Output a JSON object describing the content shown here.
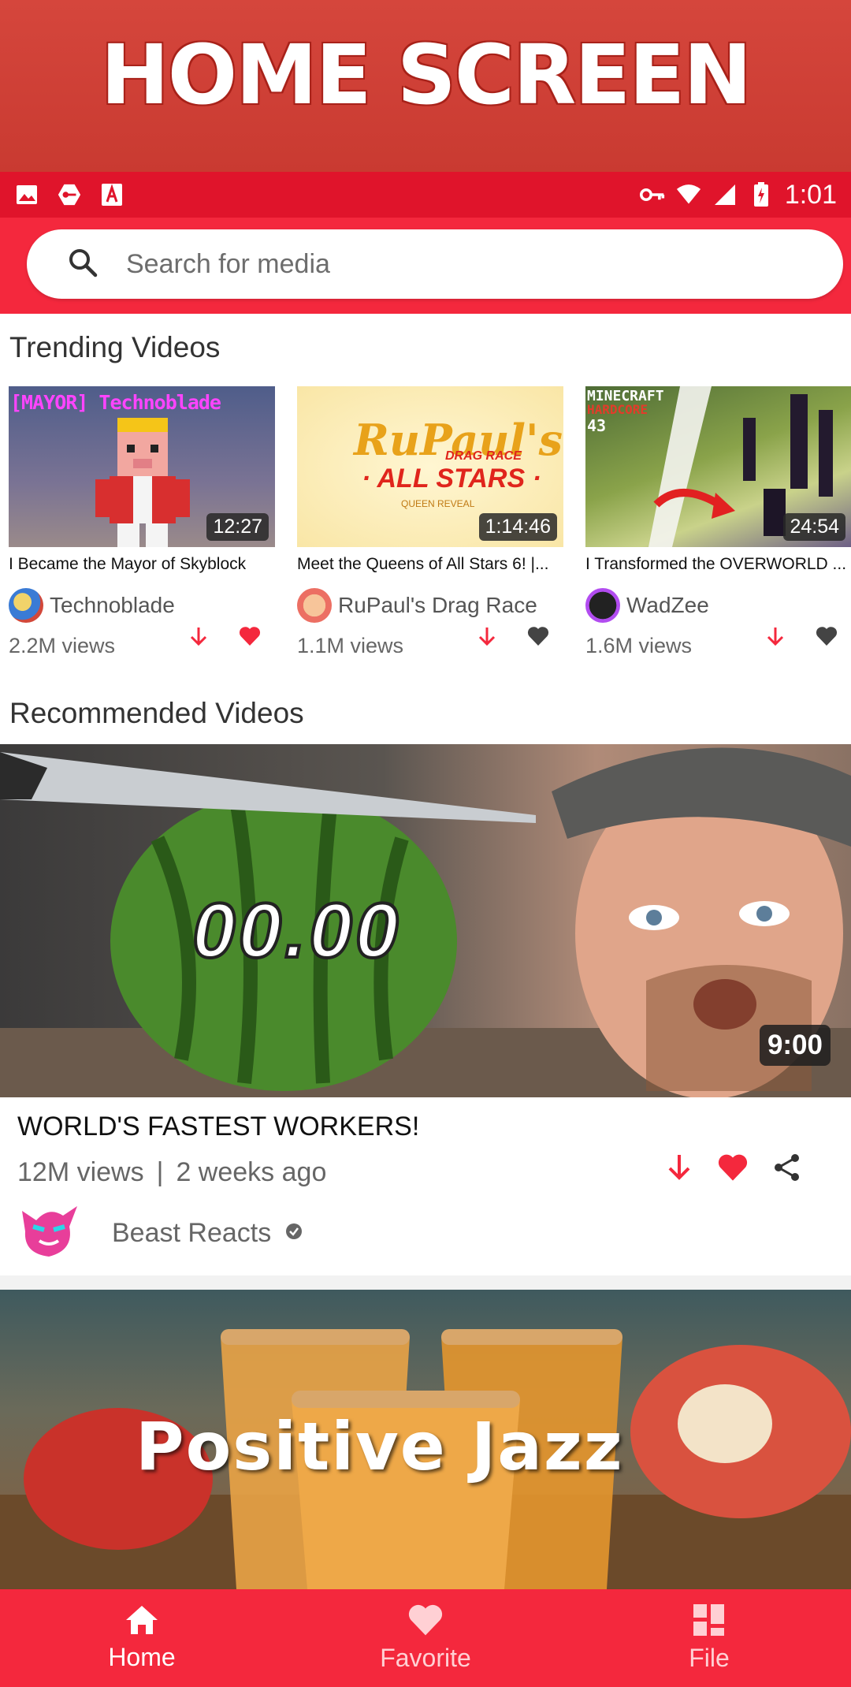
{
  "banner": {
    "title": "HOME SCREEN"
  },
  "status_bar": {
    "time": "1:01"
  },
  "search": {
    "placeholder": "Search for media"
  },
  "trending": {
    "title": "Trending Videos",
    "items": [
      {
        "title": "I Became the Mayor of Skyblock",
        "duration": "12:27",
        "channel": "Technoblade",
        "views": "2.2M views",
        "thumb_text": "[MAYOR] Technoblade",
        "favorited": true
      },
      {
        "title": "Meet the Queens of All Stars 6! |...",
        "duration": "1:14:46",
        "channel": "RuPaul's Drag Race",
        "views": "1.1M views",
        "thumb_text_1": "RuPaul's",
        "thumb_text_2": "DRAG RACE",
        "thumb_text_3": "· ALL STARS ·",
        "thumb_text_4": "QUEEN REVEAL",
        "favorited": false
      },
      {
        "title": "I Transformed the OVERWORLD ...",
        "duration": "24:54",
        "channel": "WadZee",
        "views": "1.6M views",
        "thumb_text_1": "MINECRAFT",
        "thumb_text_2": "HARDCORE",
        "thumb_text_3": "43",
        "favorited": false
      }
    ]
  },
  "recommended": {
    "title": "Recommended Videos",
    "items": [
      {
        "title": "WORLD'S FASTEST WORKERS!",
        "views": "12M views",
        "separator": "|",
        "age": "2 weeks ago",
        "channel": "Beast Reacts",
        "duration": "9:00",
        "thumb_text": "00.00",
        "favorited": true
      },
      {
        "thumb_text": "Positive Jazz"
      }
    ]
  },
  "bottom_nav": {
    "items": [
      {
        "label": "Home",
        "icon": "home-icon",
        "active": true
      },
      {
        "label": "Favorite",
        "icon": "heart-icon",
        "active": false
      },
      {
        "label": "File",
        "icon": "grid-icon",
        "active": false
      }
    ]
  },
  "colors": {
    "accent": "#f4283d",
    "status_bar": "#e0142b",
    "banner": "#d5463c"
  }
}
